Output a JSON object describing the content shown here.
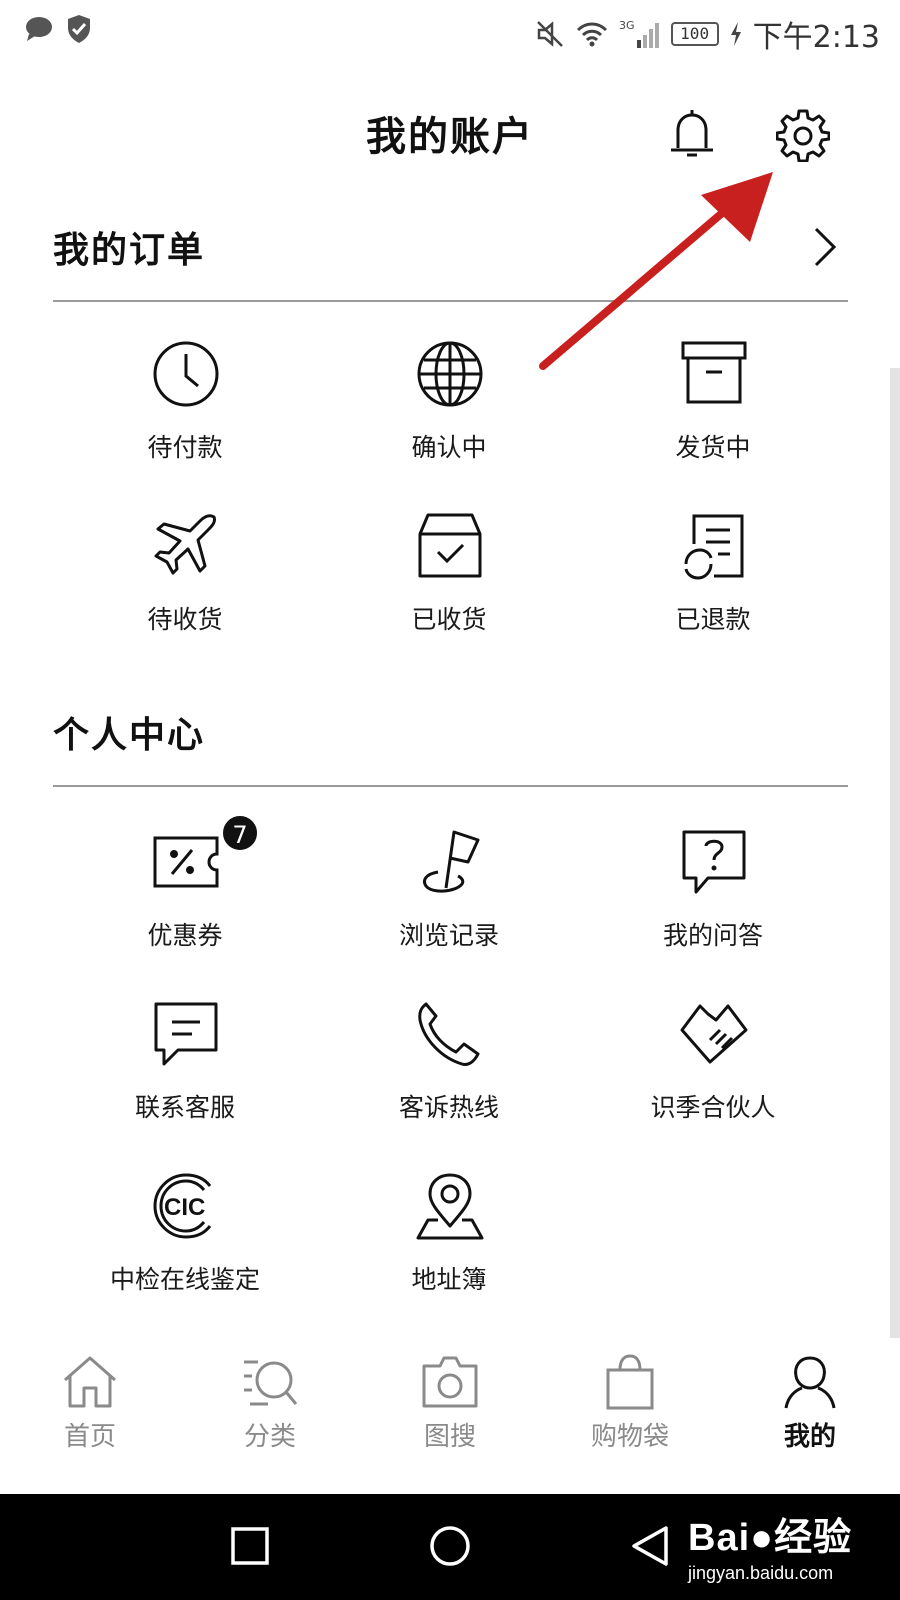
{
  "status_bar": {
    "time": "下午2:13",
    "battery": "100",
    "network": "3G",
    "icons": [
      "message-icon",
      "shield-icon",
      "mute-icon",
      "wifi-icon",
      "signal-icon",
      "battery-icon",
      "charging-icon"
    ]
  },
  "header": {
    "title": "我的账户",
    "icons": [
      "bell-icon",
      "gear-icon"
    ]
  },
  "orders": {
    "title": "我的订单",
    "items": [
      {
        "label": "待付款",
        "icon": "clock-icon"
      },
      {
        "label": "确认中",
        "icon": "globe-icon"
      },
      {
        "label": "发货中",
        "icon": "archive-box-icon"
      },
      {
        "label": "待收货",
        "icon": "airplane-icon"
      },
      {
        "label": "已收货",
        "icon": "box-check-icon"
      },
      {
        "label": "已退款",
        "icon": "refund-document-icon"
      }
    ]
  },
  "personal": {
    "title": "个人中心",
    "items": [
      {
        "label": "优惠券",
        "icon": "coupon-icon",
        "badge": "7"
      },
      {
        "label": "浏览记录",
        "icon": "flag-icon"
      },
      {
        "label": "我的问答",
        "icon": "question-bubble-icon"
      },
      {
        "label": "联系客服",
        "icon": "chat-bubble-icon"
      },
      {
        "label": "客诉热线",
        "icon": "phone-icon"
      },
      {
        "label": "识季合伙人",
        "icon": "handshake-icon"
      },
      {
        "label": "中检在线鉴定",
        "icon": "cic-logo-icon",
        "logo_text": "CIC"
      },
      {
        "label": "地址簿",
        "icon": "location-pin-icon"
      }
    ]
  },
  "bottom_nav": {
    "items": [
      {
        "label": "首页",
        "icon": "home-icon",
        "active": false
      },
      {
        "label": "分类",
        "icon": "category-search-icon",
        "active": false
      },
      {
        "label": "图搜",
        "icon": "camera-icon",
        "active": false
      },
      {
        "label": "购物袋",
        "icon": "shopping-bag-icon",
        "active": false
      },
      {
        "label": "我的",
        "icon": "user-icon",
        "active": true
      }
    ]
  },
  "system_nav": {
    "icons": [
      "recent-apps-icon",
      "home-circle-icon",
      "back-triangle-icon"
    ]
  },
  "watermark": {
    "brand": "Bai",
    "brand_suffix": "经验",
    "url": "jingyan.baidu.com"
  },
  "annotation": {
    "arrow_color": "#c8201e",
    "points_to": "gear-icon"
  },
  "colors": {
    "text": "#111111",
    "inactive": "#8a8a8a",
    "divider": "#9a9a9a",
    "badge": "#111111"
  }
}
